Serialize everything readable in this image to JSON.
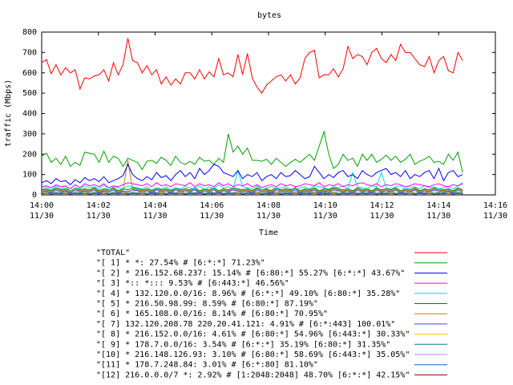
{
  "chart_data": {
    "type": "line",
    "title": "bytes",
    "xlabel": "Time",
    "ylabel": "traffic (Mbps)",
    "ylim": [
      0,
      800
    ],
    "yticks": [
      "0",
      "100",
      "200",
      "300",
      "400",
      "500",
      "600",
      "700",
      "800"
    ],
    "xticks": [
      {
        "time": "14:00",
        "date": "11/30"
      },
      {
        "time": "14:02",
        "date": "11/30"
      },
      {
        "time": "14:04",
        "date": "11/30"
      },
      {
        "time": "14:06",
        "date": "11/30"
      },
      {
        "time": "14:08",
        "date": "11/30"
      },
      {
        "time": "14:10",
        "date": "11/30"
      },
      {
        "time": "14:12",
        "date": "11/30"
      },
      {
        "time": "14:14",
        "date": "11/30"
      },
      {
        "time": "14:16",
        "date": "11/30"
      }
    ],
    "x_minutes_range": [
      0,
      16
    ],
    "grid": false,
    "legend_position": "bottom",
    "series": [
      {
        "name": "\"TOTAL\"",
        "color": "#ff0000",
        "values": [
          650,
          665,
          595,
          640,
          590,
          625,
          600,
          615,
          520,
          575,
          570,
          585,
          590,
          615,
          560,
          650,
          590,
          640,
          770,
          660,
          650,
          600,
          635,
          590,
          615,
          545,
          580,
          540,
          570,
          545,
          600,
          600,
          570,
          615,
          570,
          605,
          580,
          670,
          590,
          600,
          580,
          690,
          590,
          695,
          575,
          530,
          500,
          540,
          560,
          580,
          590,
          560,
          590,
          545,
          575,
          670,
          700,
          710,
          575,
          590,
          590,
          620,
          580,
          620,
          730,
          670,
          690,
          680,
          640,
          700,
          720,
          670,
          650,
          690,
          660,
          740,
          700,
          700,
          670,
          640,
          630,
          680,
          600,
          660,
          680,
          610,
          600,
          700,
          660
        ]
      },
      {
        "name": "\"[ 1] * *: 27.54% # [6:*:*] 71.23%\"",
        "color": "#00a000",
        "values": [
          190,
          205,
          160,
          180,
          150,
          190,
          140,
          160,
          145,
          210,
          205,
          200,
          160,
          215,
          160,
          190,
          180,
          140,
          180,
          170,
          160,
          125,
          165,
          170,
          155,
          185,
          170,
          145,
          190,
          160,
          150,
          165,
          150,
          185,
          165,
          170,
          150,
          180,
          160,
          300,
          210,
          240,
          200,
          230,
          170,
          170,
          165,
          175,
          150,
          180,
          160,
          140,
          160,
          175,
          160,
          180,
          200,
          170,
          240,
          310,
          200,
          130,
          150,
          200,
          170,
          180,
          140,
          200,
          170,
          200,
          160,
          175,
          195,
          170,
          190,
          160,
          175,
          200,
          150,
          165,
          175,
          190,
          160,
          165,
          150,
          200,
          170,
          210,
          110
        ]
      },
      {
        "name": "\"[ 2] * 216.152.68.237: 15.14% # [6:80:*] 55.27% [6:*:*] 43.67%\"",
        "color": "#0000ff",
        "values": [
          60,
          70,
          55,
          80,
          65,
          70,
          50,
          75,
          60,
          85,
          70,
          80,
          65,
          90,
          60,
          70,
          80,
          95,
          150,
          100,
          80,
          70,
          90,
          75,
          110,
          85,
          95,
          70,
          100,
          120,
          90,
          110,
          80,
          130,
          100,
          120,
          150,
          140,
          110,
          100,
          90,
          120,
          80,
          100,
          90,
          110,
          70,
          90,
          100,
          80,
          110,
          90,
          95,
          120,
          100,
          80,
          90,
          140,
          110,
          80,
          100,
          85,
          110,
          120,
          90,
          100,
          80,
          120,
          100,
          90,
          110,
          120,
          130,
          100,
          110,
          90,
          120,
          80,
          100,
          90,
          110,
          120,
          80,
          130,
          70,
          110,
          120,
          90,
          100
        ]
      },
      {
        "name": "\"[ 3] *:: *::: 9.53% # [6:443:*] 46.56%\"",
        "color": "#ff00ff",
        "values": [
          40,
          45,
          35,
          50,
          40,
          45,
          30,
          50,
          35,
          55,
          45,
          50,
          40,
          55,
          35,
          45,
          40,
          50,
          60,
          55,
          50,
          45,
          55,
          40,
          60,
          45,
          50,
          40,
          55,
          50,
          45,
          60,
          40,
          55,
          45,
          50,
          40,
          60,
          45,
          55,
          40,
          50,
          45,
          55,
          40,
          50,
          35,
          45,
          50,
          40,
          55,
          45,
          50,
          40,
          45,
          55,
          50,
          45,
          60,
          40,
          50,
          45,
          55,
          40,
          50,
          45,
          55,
          60,
          50,
          45,
          55,
          40,
          50,
          45,
          55,
          50,
          40,
          45,
          55,
          50,
          45,
          40,
          50,
          55,
          45,
          40,
          50,
          45,
          55
        ]
      },
      {
        "name": "\"[ 4] * 132.120.0.0/16: 8.96% # [6:*:*] 49.10% [6:80:*] 35.28%\"",
        "color": "#00e0e0",
        "values": [
          30,
          40,
          25,
          45,
          30,
          40,
          20,
          35,
          30,
          45,
          35,
          40,
          30,
          50,
          25,
          40,
          35,
          30,
          45,
          40,
          35,
          30,
          40,
          25,
          35,
          30,
          40,
          25,
          35,
          30,
          40,
          35,
          30,
          45,
          25,
          40,
          30,
          50,
          35,
          40,
          30,
          120,
          40,
          35,
          30,
          45,
          25,
          35,
          40,
          30,
          35,
          40,
          30,
          25,
          35,
          40,
          30,
          45,
          40,
          35,
          30,
          40,
          35,
          45,
          30,
          110,
          40,
          35,
          30,
          45,
          40,
          110,
          35,
          30,
          40,
          45,
          30,
          35,
          40,
          30,
          45,
          35,
          40,
          30,
          35,
          40,
          30,
          45,
          60
        ]
      },
      {
        "name": "\"[ 5] * 216.50.98.99: 8.59% # [6:80:*] 87.19%\"",
        "color": "#008000",
        "values": [
          25,
          30,
          20,
          35,
          25,
          30,
          20,
          35,
          25,
          30,
          25,
          35,
          20,
          30,
          25,
          35,
          20,
          30,
          25,
          35,
          30,
          25,
          30,
          20,
          35,
          25,
          30,
          20,
          35,
          25,
          30,
          25,
          35,
          20,
          30,
          25,
          35,
          20,
          30,
          25,
          35,
          30,
          25,
          30,
          20,
          35,
          25,
          30,
          20,
          35,
          25,
          30,
          25,
          35,
          20,
          30,
          25,
          35,
          20,
          30,
          25,
          35,
          30,
          25,
          30,
          20,
          35,
          25,
          30,
          20,
          35,
          25,
          30,
          25,
          35,
          20,
          30,
          25,
          35,
          20,
          30,
          25,
          35,
          30,
          25,
          30,
          20,
          35,
          25
        ]
      },
      {
        "name": "\"[ 6] * 165.108.0.0/16: 8.14% # [6:80:*] 70.95%\"",
        "color": "#b8860b",
        "values": [
          20,
          25,
          15,
          30,
          20,
          25,
          15,
          30,
          20,
          25,
          20,
          30,
          15,
          25,
          20,
          30,
          15,
          25,
          170,
          30,
          25,
          20,
          25,
          15,
          30,
          20,
          25,
          15,
          30,
          20,
          25,
          20,
          30,
          15,
          25,
          20,
          30,
          15,
          25,
          20,
          30,
          25,
          20,
          25,
          15,
          30,
          20,
          25,
          15,
          30,
          20,
          25,
          20,
          30,
          15,
          25,
          20,
          30,
          15,
          25,
          20,
          30,
          25,
          20,
          25,
          15,
          30,
          20,
          25,
          15,
          30,
          20,
          25,
          20,
          30,
          15,
          25,
          20,
          30,
          15,
          25,
          20,
          30,
          25,
          20,
          25,
          15,
          30,
          20
        ]
      },
      {
        "name": "\"[ 7] 132.120.208.78 220.20.41.121: 4.91% # [6:*:443] 100.01%\"",
        "color": "#4040ff",
        "values": [
          15,
          20,
          10,
          25,
          15,
          20,
          10,
          25,
          15,
          20,
          15,
          25,
          10,
          20,
          15,
          25,
          10,
          20,
          15,
          25,
          20,
          15,
          20,
          10,
          25,
          15,
          20,
          10,
          25,
          15,
          20,
          15,
          25,
          10,
          20,
          15,
          25,
          10,
          20,
          15,
          25,
          20,
          15,
          20,
          10,
          25,
          15,
          20,
          10,
          25,
          15,
          20,
          15,
          25,
          10,
          20,
          15,
          25,
          10,
          20,
          15,
          25,
          20,
          15,
          20,
          10,
          25,
          15,
          20,
          10,
          25,
          15,
          20,
          15,
          25,
          10,
          20,
          15,
          25,
          10,
          20,
          15,
          25,
          20,
          15,
          20,
          10,
          25,
          15
        ]
      },
      {
        "name": "\"[ 8] * 216.152.0.0/16: 4.61% # [6:80:*] 54.96% [6:443:*] 30.33%\"",
        "color": "#ffc000",
        "values": [
          15,
          10,
          20,
          15,
          25,
          10,
          20,
          15,
          25,
          10,
          20,
          15,
          25,
          10,
          20,
          15,
          25,
          10,
          20,
          15,
          25,
          10,
          20,
          15,
          25,
          10,
          20,
          15,
          25,
          10,
          20,
          15,
          25,
          10,
          20,
          15,
          25,
          10,
          20,
          15,
          25,
          10,
          20,
          15,
          25,
          10,
          20,
          15,
          25,
          10,
          20,
          15,
          25,
          10,
          20,
          15,
          25,
          10,
          20,
          15,
          25,
          10,
          20,
          15,
          25,
          10,
          20,
          15,
          25,
          10,
          20,
          15,
          25,
          10,
          20,
          15,
          25,
          10,
          20,
          15,
          25,
          10,
          20,
          15,
          25,
          10,
          20,
          15,
          25
        ]
      },
      {
        "name": "\"[ 9] * 178.7.0.0/16: 3.54% # [6:*:*] 35.19% [6:80:*] 31.35%\"",
        "color": "#008080",
        "values": [
          10,
          15,
          8,
          12,
          10,
          15,
          8,
          12,
          10,
          15,
          8,
          12,
          10,
          15,
          8,
          12,
          10,
          15,
          8,
          12,
          10,
          15,
          8,
          12,
          10,
          15,
          8,
          12,
          10,
          15,
          8,
          12,
          10,
          15,
          8,
          12,
          10,
          15,
          8,
          12,
          10,
          15,
          8,
          12,
          10,
          15,
          8,
          12,
          10,
          15,
          8,
          12,
          10,
          15,
          8,
          12,
          10,
          15,
          8,
          12,
          10,
          15,
          8,
          12,
          10,
          15,
          8,
          12,
          10,
          15,
          8,
          12,
          10,
          15,
          8,
          12,
          10,
          15,
          8,
          12,
          10,
          15,
          8,
          12,
          10,
          15,
          8,
          12,
          10
        ]
      },
      {
        "name": "\"[10] * 216.148.126.93: 3.10% # [6:80:*] 58.69% [6:443:*] 35.05%\"",
        "color": "#c080ff",
        "values": [
          8,
          12,
          6,
          10,
          8,
          12,
          6,
          10,
          8,
          12,
          6,
          10,
          8,
          12,
          6,
          10,
          8,
          12,
          6,
          10,
          8,
          12,
          6,
          10,
          8,
          12,
          6,
          10,
          8,
          12,
          6,
          10,
          8,
          12,
          6,
          10,
          8,
          12,
          6,
          10,
          8,
          12,
          6,
          10,
          8,
          12,
          6,
          10,
          8,
          12,
          6,
          10,
          8,
          12,
          6,
          10,
          8,
          12,
          6,
          10,
          8,
          12,
          6,
          10,
          8,
          12,
          6,
          10,
          8,
          12,
          6,
          10,
          8,
          12,
          6,
          10,
          8,
          12,
          6,
          10,
          8,
          12,
          6,
          10,
          8,
          12,
          6,
          10,
          8
        ]
      },
      {
        "name": "\"[11] * 178.7.248.84: 3.01% # [6:*:80] 81.10%\"",
        "color": "#1060c0",
        "values": [
          6,
          10,
          5,
          8,
          6,
          10,
          5,
          8,
          6,
          10,
          5,
          8,
          6,
          10,
          5,
          8,
          6,
          10,
          5,
          8,
          6,
          10,
          5,
          8,
          6,
          10,
          5,
          8,
          6,
          10,
          5,
          8,
          6,
          10,
          5,
          8,
          6,
          10,
          5,
          8,
          6,
          10,
          5,
          8,
          6,
          10,
          5,
          8,
          6,
          10,
          5,
          8,
          6,
          10,
          5,
          8,
          6,
          10,
          5,
          8,
          6,
          10,
          5,
          8,
          6,
          10,
          5,
          8,
          6,
          10,
          5,
          8,
          6,
          10,
          5,
          8,
          6,
          10,
          5,
          8,
          6,
          10,
          5,
          8,
          6,
          10,
          5,
          8,
          6
        ]
      },
      {
        "name": "\"[12] 216.0.0.0/7 *: 2.92% # [1:2048:2048] 48.70% [6:*:*] 42.15%\"",
        "color": "#8b0000",
        "values": [
          5,
          8,
          4,
          7,
          5,
          8,
          4,
          7,
          5,
          8,
          4,
          7,
          5,
          8,
          4,
          7,
          5,
          8,
          4,
          7,
          5,
          8,
          4,
          7,
          5,
          8,
          4,
          7,
          5,
          8,
          4,
          7,
          5,
          8,
          4,
          7,
          5,
          8,
          4,
          7,
          5,
          8,
          4,
          7,
          5,
          8,
          4,
          7,
          5,
          8,
          4,
          7,
          5,
          8,
          4,
          7,
          5,
          8,
          4,
          7,
          5,
          8,
          4,
          7,
          5,
          8,
          4,
          7,
          5,
          8,
          4,
          7,
          5,
          8,
          4,
          7,
          5,
          8,
          4,
          7,
          5,
          8,
          4,
          7,
          5,
          8,
          4,
          7,
          5
        ]
      }
    ]
  }
}
